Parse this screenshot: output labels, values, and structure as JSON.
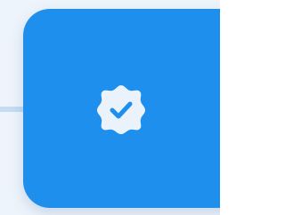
{
  "colors": {
    "background": "#eef4fb",
    "tile": "#1e8fec",
    "connector": "#c5dcf3",
    "badge_fill": "#eaf2fb",
    "check_stroke": "#1e8fec"
  },
  "tile": {
    "icon": "verified-badge-icon"
  }
}
